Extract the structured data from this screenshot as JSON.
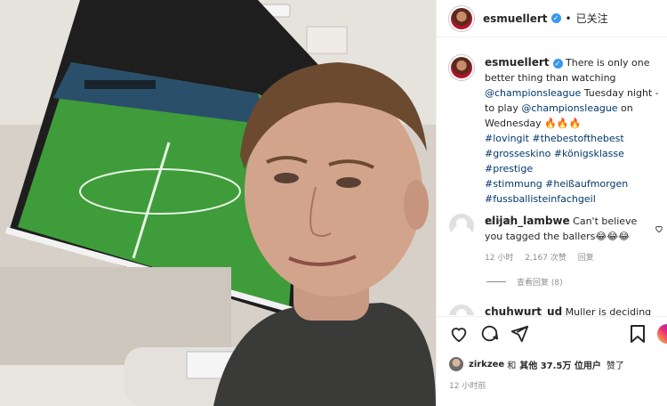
{
  "post": {
    "author": "esmuellert",
    "follow_status": "已关注",
    "separator": "•",
    "caption_lines": {
      "text1": "There is only one better thing than watching ",
      "mention1": "@championsleague",
      "text2": " Tuesday night - to play ",
      "mention2": "@championsleague",
      "text3": " on Wednesday 🔥🔥🔥",
      "hashtags1": "#lovingit #thebestofthebest",
      "hashtags2": "#grosseskino #königsklasse #prestige",
      "hashtags3": "#stimmung #heißaufmorgen",
      "hashtags4": "#fussballisteinfachgeil"
    },
    "caption_time": "12 小时"
  },
  "comment": {
    "user": "elijah_lambwe",
    "text": "Can't believe you tagged the ballers😂😂😂",
    "time": "12 小时",
    "likes": "2,167 次赞",
    "reply": "回复",
    "view_replies": "查看回复 (8)"
  },
  "next_comment": {
    "user": "chuhwurt_ud",
    "text": "Muller is deciding"
  },
  "footer": {
    "liker": "zirkzee",
    "and": "和",
    "others": "其他 37.5万 位用户",
    "liked": "赞了",
    "time": "12 小时前"
  },
  "icons": [
    "heart-icon",
    "comment-icon",
    "share-icon",
    "bookmark-icon",
    "verified-icon"
  ],
  "colors": {
    "link": "#00376b",
    "verified": "#3897f0",
    "muted": "#8e8e8e"
  }
}
